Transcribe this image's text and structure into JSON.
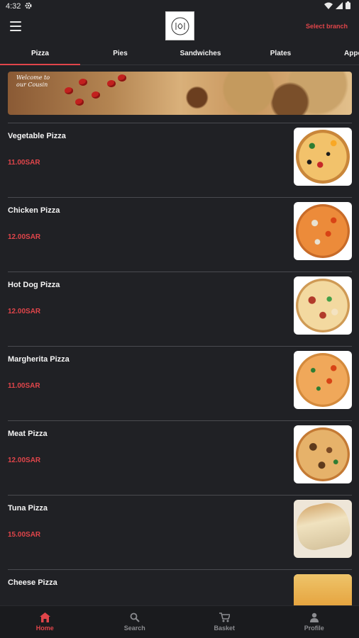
{
  "status": {
    "time": "4:32"
  },
  "header": {
    "select_branch": "Select branch"
  },
  "tabs": [
    {
      "label": "Pizza"
    },
    {
      "label": "Pies"
    },
    {
      "label": "Sandwiches"
    },
    {
      "label": "Plates"
    },
    {
      "label": "Appe"
    }
  ],
  "banner": {
    "text": "Welcome to our Cousin"
  },
  "items": [
    {
      "name": "Vegetable Pizza",
      "price": "11.00SAR"
    },
    {
      "name": "Chicken Pizza",
      "price": "12.00SAR"
    },
    {
      "name": "Hot Dog Pizza",
      "price": "12.00SAR"
    },
    {
      "name": "Margherita Pizza",
      "price": "11.00SAR"
    },
    {
      "name": "Meat Pizza",
      "price": "12.00SAR"
    },
    {
      "name": "Tuna Pizza",
      "price": "15.00SAR"
    },
    {
      "name": "Cheese Pizza",
      "price": ""
    }
  ],
  "bottom_nav": [
    {
      "label": "Home",
      "icon": "home-icon"
    },
    {
      "label": "Search",
      "icon": "search-icon"
    },
    {
      "label": "Basket",
      "icon": "cart-icon"
    },
    {
      "label": "Profile",
      "icon": "profile-icon"
    }
  ],
  "colors": {
    "accent": "#e0454a",
    "background": "#202125",
    "nav_background": "#1a1b1e"
  }
}
